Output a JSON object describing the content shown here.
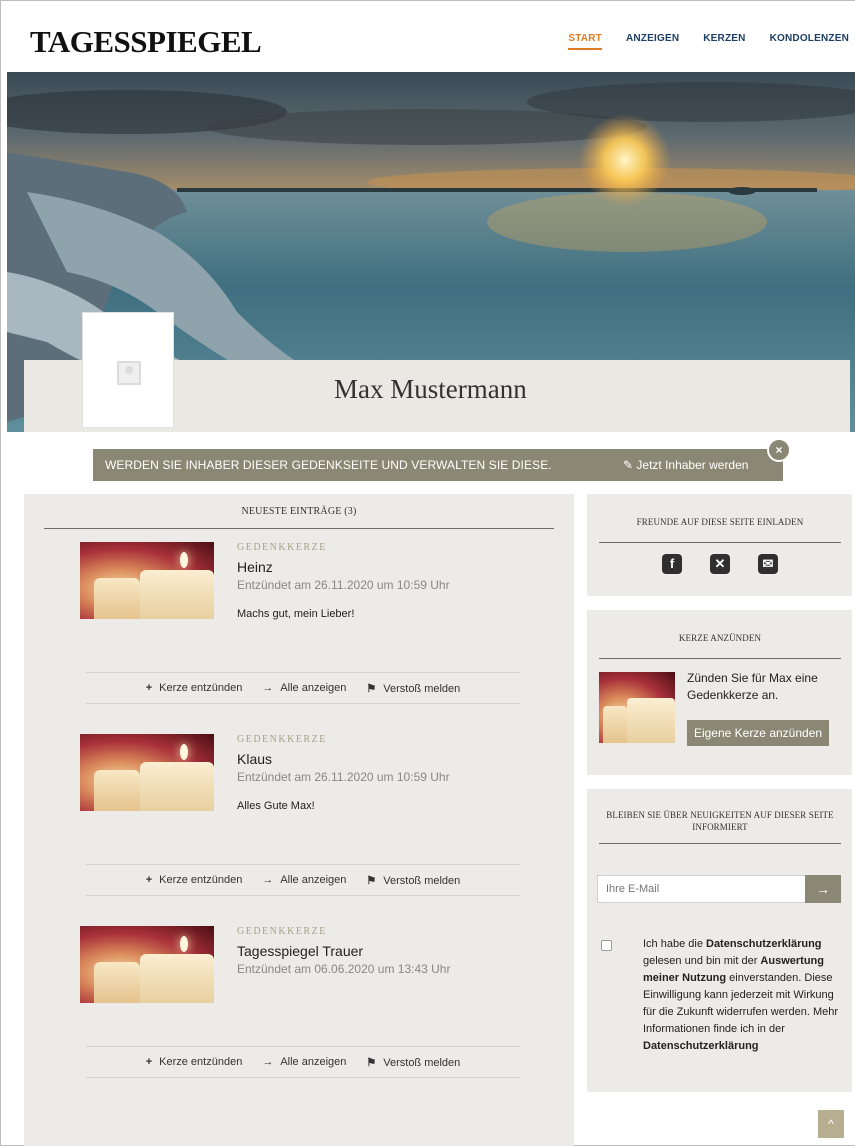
{
  "header": {
    "logo": "TAGESSPIEGEL",
    "nav": [
      "START",
      "ANZEIGEN",
      "KERZEN",
      "KONDOLENZEN"
    ],
    "active_nav": "START"
  },
  "profile": {
    "name": "Max Mustermann"
  },
  "banner": {
    "text": "WERDEN SIE INHABER DIESER GEDENKSEITE UND VERWALTEN SIE DIESE.",
    "action": "Jetzt Inhaber werden",
    "close": "×"
  },
  "entries": {
    "heading": "NEUESTE EINTRÄGE (3)",
    "items": [
      {
        "category": "GEDENKKERZE",
        "name": "Heinz",
        "date": "Entzündet am 26.11.2020 um 10:59 Uhr",
        "message": "Machs gut, mein Lieber!"
      },
      {
        "category": "GEDENKKERZE",
        "name": "Klaus",
        "date": "Entzündet am 26.11.2020 um 10:59 Uhr",
        "message": "Alles Gute Max!"
      },
      {
        "category": "GEDENKKERZE",
        "name": "Tagesspiegel Trauer",
        "date": "Entzündet am 06.06.2020 um 13:43 Uhr",
        "message": ""
      }
    ],
    "actions": {
      "light": "Kerze entzünden",
      "all": "Alle anzeigen",
      "report": "Verstoß melden"
    }
  },
  "sidebar": {
    "invite": {
      "heading": "FREUNDE AUF DIESE SEITE EINLADEN",
      "icons": [
        "facebook-icon",
        "x-icon",
        "mail-icon"
      ]
    },
    "candle": {
      "heading": "KERZE ANZÜNDEN",
      "text": "Zünden Sie für Max eine Gedenkkerze an.",
      "button": "Eigene Kerze anzünden"
    },
    "newsletter": {
      "heading": "BLEIBEN SIE ÜBER NEUIGKEITEN AUF DIESER SEITE INFORMIERT",
      "email_placeholder": "Ihre E-Mail",
      "consent": [
        {
          "text": "Ich habe die ",
          "bold": false
        },
        {
          "text": "Datenschutzerklärung",
          "bold": true
        },
        {
          "text": " gelesen und bin mit der ",
          "bold": false
        },
        {
          "text": "Auswertung meiner Nutzung",
          "bold": true
        },
        {
          "text": " einverstanden. Diese Einwilligung kann jederzeit mit Wirkung für die Zukunft widerrufen werden. Mehr Informationen finde ich in der ",
          "bold": false
        },
        {
          "text": "Datenschutzerklärung",
          "bold": true
        }
      ]
    }
  },
  "colors": {
    "accent": "#8a8874",
    "nav_active": "#e07b23",
    "nav": "#1d3e63",
    "panel": "#ecebe7"
  }
}
